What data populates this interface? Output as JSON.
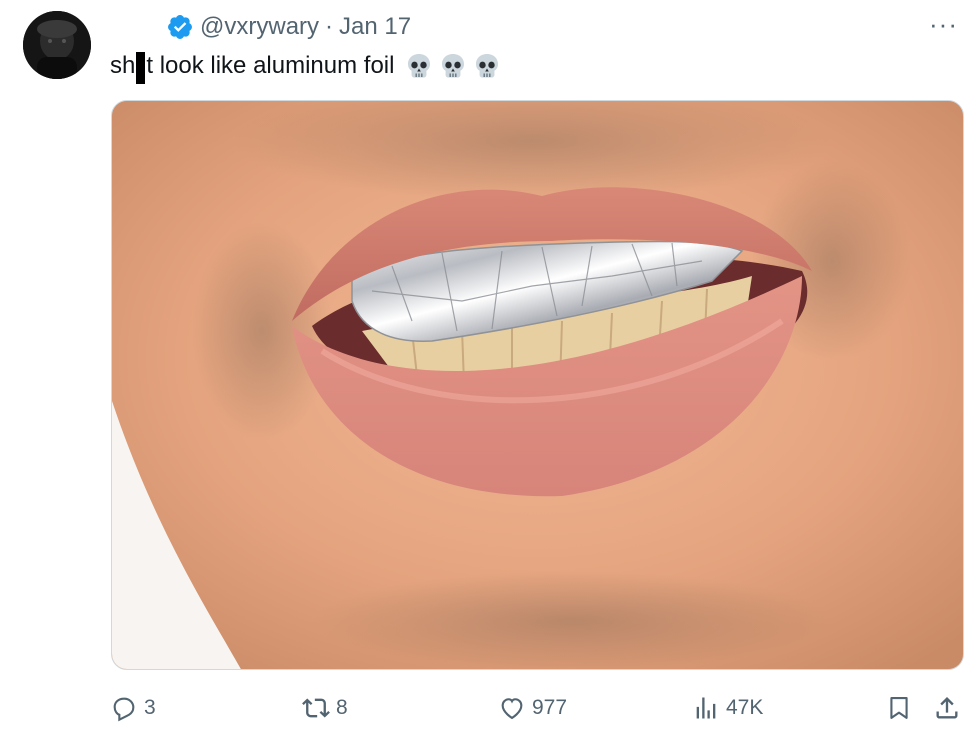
{
  "tweet": {
    "handle": "@vxrywary",
    "separator": "·",
    "date": "Jan 17",
    "more_label": "···",
    "text_part1": "sh",
    "text_part2": "t look like aluminum foil",
    "emoji": [
      "skull-emoji",
      "skull-emoji",
      "skull-emoji"
    ],
    "media_icon": "photo-of-mouth-with-foil-grill"
  },
  "actions": {
    "replies": "3",
    "retweets": "8",
    "likes": "977",
    "views": "47K"
  },
  "colors": {
    "text": "#0f1419",
    "secondary": "#536471",
    "verified": "#1d9bf0",
    "border": "#cfd9de"
  }
}
